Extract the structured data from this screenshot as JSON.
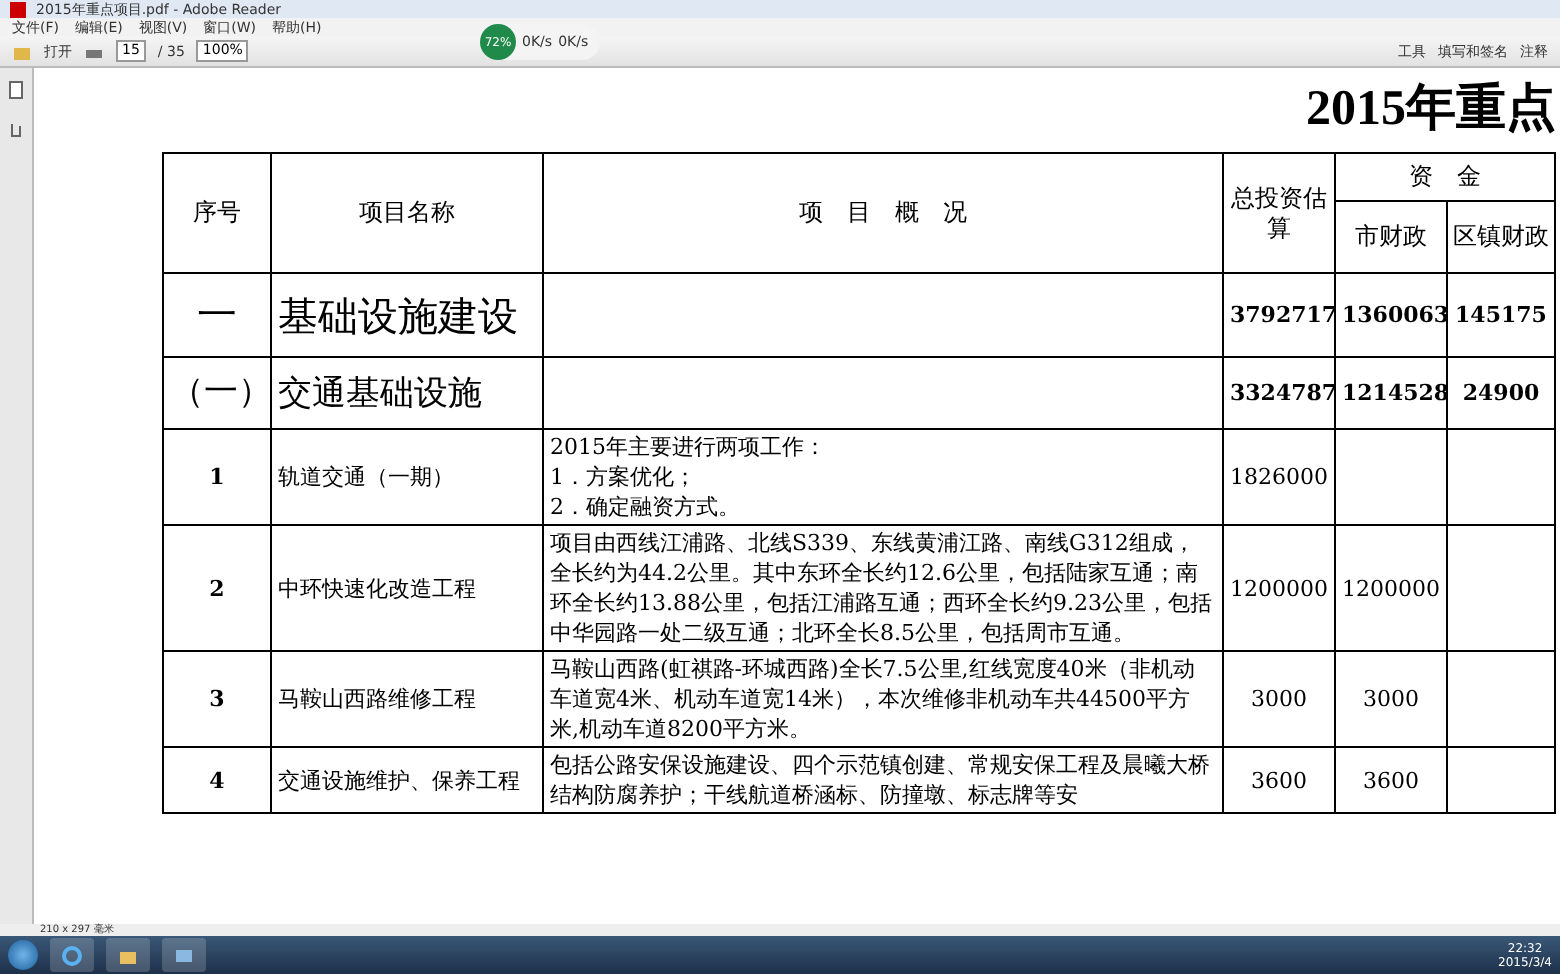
{
  "window": {
    "title": "2015年重点项目.pdf - Adobe Reader"
  },
  "menu": [
    "文件(F)",
    "编辑(E)",
    "视图(V)",
    "窗口(W)",
    "帮助(H)"
  ],
  "toolbar": {
    "open_label": "打开",
    "page": "15",
    "page_total": "/ 35",
    "zoom": "100%",
    "right": [
      "工具",
      "填写和签名",
      "注释"
    ]
  },
  "net_meter": {
    "percent": "72%",
    "up": "0K/s",
    "down": "0K/s"
  },
  "document": {
    "title": "2015年重点",
    "columns": {
      "index": "序号",
      "name": "项目名称",
      "summary": "项　目　概　况",
      "total": "总投资估算",
      "funds": "资　金",
      "city": "市财政",
      "town": "区镇财政"
    },
    "rows": [
      {
        "kind": "category",
        "index": "一",
        "name": "基础设施建设",
        "summary": "",
        "total": "3792717",
        "city": "1360063",
        "town": "145175"
      },
      {
        "kind": "subcategory",
        "index": "（一）",
        "name": "交通基础设施",
        "summary": "",
        "total": "3324787",
        "city": "1214528",
        "town": "24900"
      },
      {
        "kind": "project",
        "index": "1",
        "name": "轨道交通（一期）",
        "summary": "2015年主要进行两项工作：\n1．方案优化；\n2．确定融资方式。",
        "total": "1826000",
        "city": "",
        "town": ""
      },
      {
        "kind": "project",
        "index": "2",
        "name": "中环快速化改造工程",
        "summary": "项目由西线江浦路、北线S339、东线黄浦江路、南线G312组成，全长约为44.2公里。其中东环全长约12.6公里，包括陆家互通；南环全长约13.88公里，包括江浦路互通；西环全长约9.23公里，包括中华园路一处二级互通；北环全长8.5公里，包括周市互通。",
        "total": "1200000",
        "city": "1200000",
        "town": ""
      },
      {
        "kind": "project",
        "index": "3",
        "name": "马鞍山西路维修工程",
        "summary": "马鞍山西路(虹祺路-环城西路)全长7.5公里,红线宽度40米（非机动车道宽4米、机动车道宽14米），本次维修非机动车共44500平方米,机动车道8200平方米。",
        "total": "3000",
        "city": "3000",
        "town": ""
      },
      {
        "kind": "project",
        "index": "4",
        "name": "交通设施维护、保养工程",
        "summary": "包括公路安保设施建设、四个示范镇创建、常规安保工程及晨曦大桥结构防腐养护；干线航道桥涵标、防撞墩、标志牌等安",
        "total": "3600",
        "city": "3600",
        "town": ""
      }
    ]
  },
  "status": {
    "page_size": "210 x 297 毫米"
  },
  "taskbar": {
    "time": "22:32",
    "date": "2015/3/4"
  }
}
